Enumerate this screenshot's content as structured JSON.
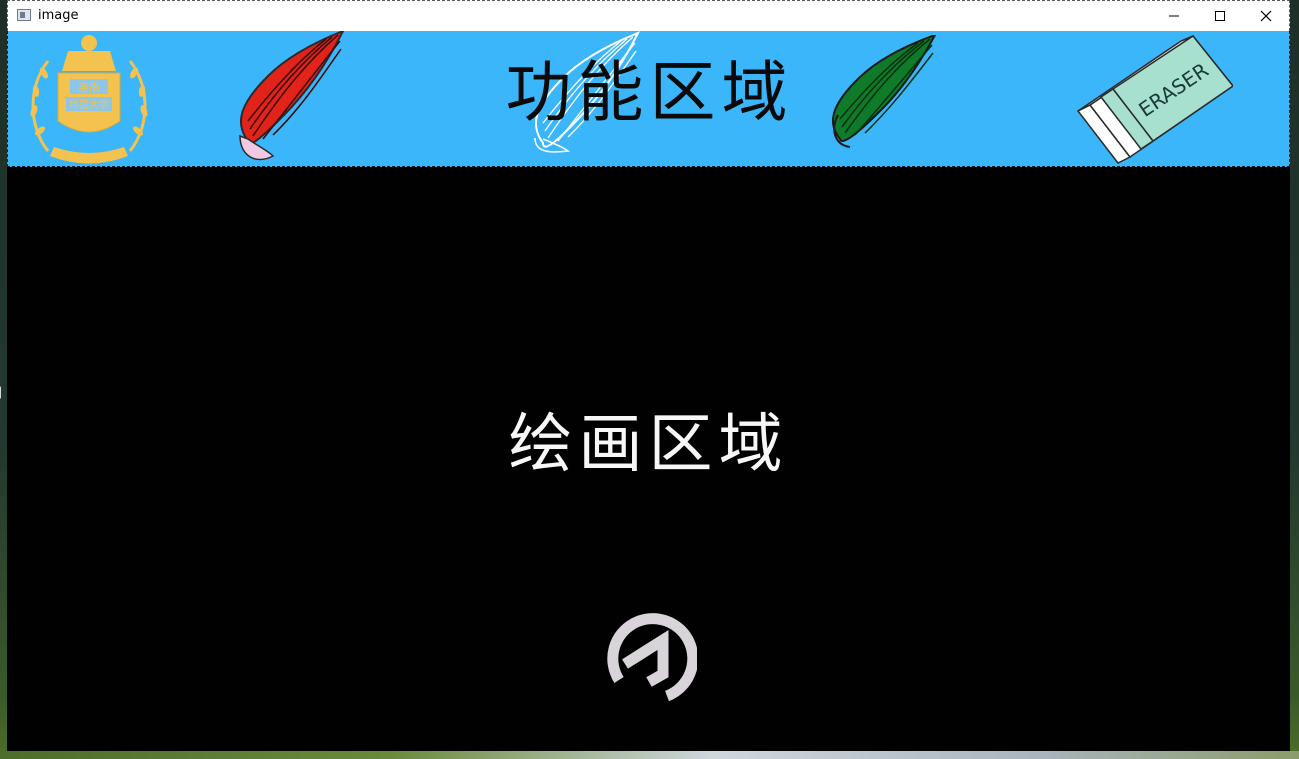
{
  "window": {
    "title": "image"
  },
  "toolbar": {
    "title": "功能区域",
    "colors": {
      "background": "#3bb6fb",
      "red_brush": "#e2231a",
      "green_brush": "#0f7a2a",
      "logo_gold": "#f4c24e",
      "eraser_mint": "#a8e0cf"
    },
    "tools": [
      {
        "name": "university-logo",
        "kind": "logo"
      },
      {
        "name": "red-brush",
        "kind": "brush",
        "color": "red"
      },
      {
        "name": "white-brush",
        "kind": "brush",
        "color": "white"
      },
      {
        "name": "green-brush",
        "kind": "brush",
        "color": "green"
      },
      {
        "name": "eraser",
        "kind": "eraser"
      }
    ],
    "logo_text": {
      "line1": "淮南",
      "line2": "师范大学"
    },
    "eraser_label": "ERASER"
  },
  "canvas": {
    "title": "绘画区域",
    "background": "#010101",
    "logo_icon": "circular-a-logo-icon"
  }
}
